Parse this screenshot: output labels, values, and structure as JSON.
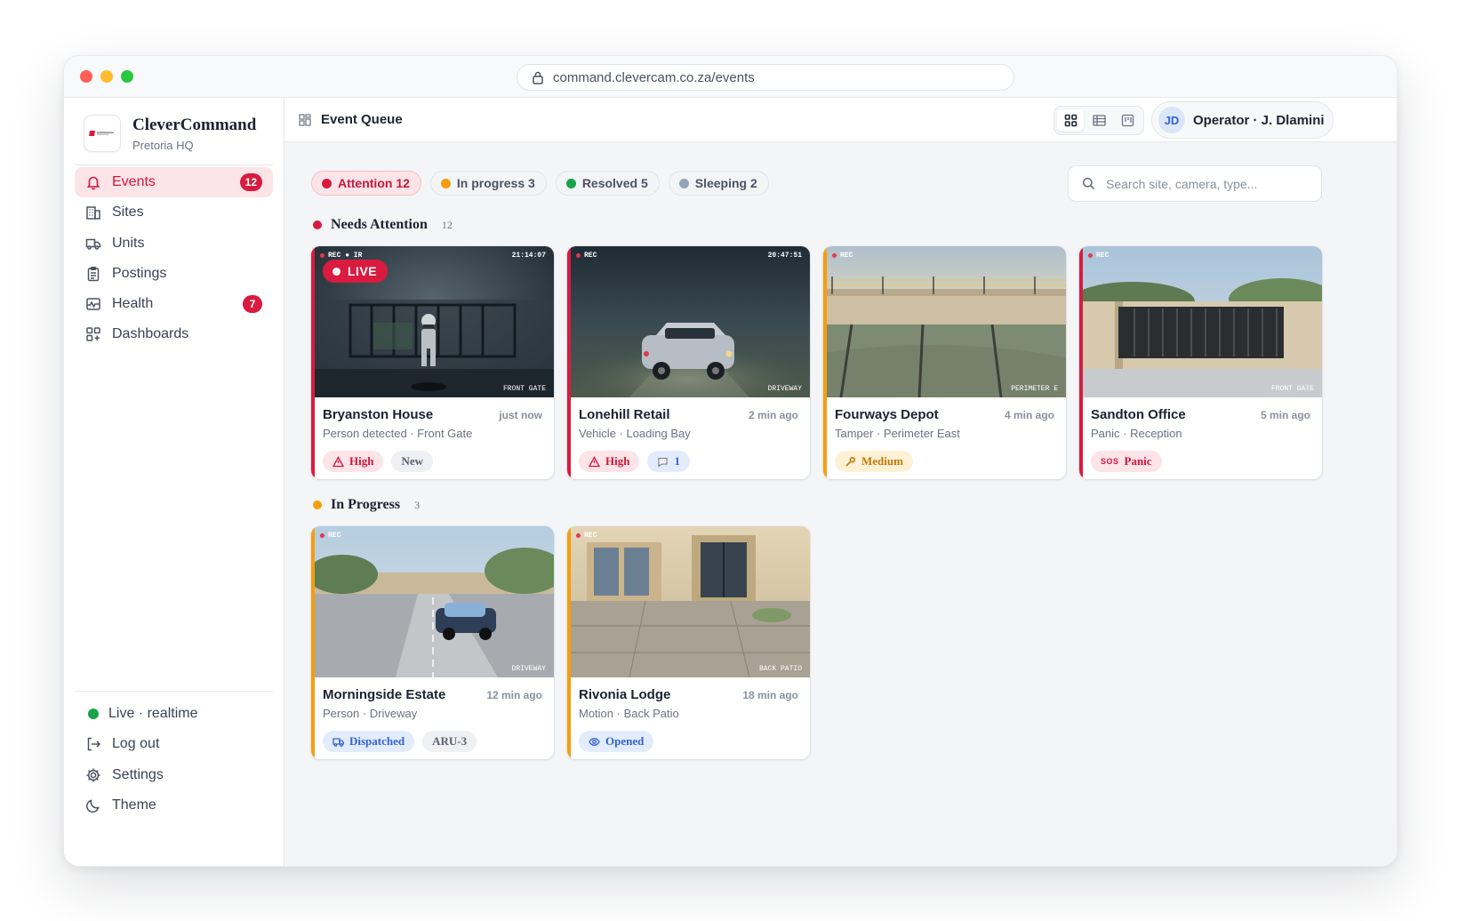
{
  "browser": {
    "url": "command.clevercam.co.za/events"
  },
  "brand": {
    "name": "CleverCommand",
    "location": "Pretoria HQ"
  },
  "nav": [
    {
      "label": "Events",
      "icon": "bell-icon",
      "badge": "12",
      "active": true
    },
    {
      "label": "Sites",
      "icon": "building-icon"
    },
    {
      "label": "Units",
      "icon": "truck-icon"
    },
    {
      "label": "Postings",
      "icon": "clipboard-icon"
    },
    {
      "label": "Health",
      "icon": "pulse-icon",
      "badge": "7"
    },
    {
      "label": "Dashboards",
      "icon": "dashboard-icon"
    }
  ],
  "sidebar_bottom": {
    "status": "Live · realtime",
    "logout": "Log out",
    "settings": "Settings",
    "theme": "Theme"
  },
  "topbar": {
    "title": "Event Queue",
    "operator_initials": "JD",
    "operator_name": "Operator · J. Dlamini",
    "view_modes": [
      "grid",
      "list",
      "map"
    ]
  },
  "filters": [
    {
      "label": "Attention 12",
      "color": "#d81b3f",
      "active": true
    },
    {
      "label": "In progress 3",
      "color": "#f59e0b"
    },
    {
      "label": "Resolved 5",
      "color": "#19a34a"
    },
    {
      "label": "Sleeping 2",
      "color": "#94a3b8"
    }
  ],
  "search": {
    "placeholder": "Search site, camera, type..."
  },
  "sections": {
    "attention": {
      "title": "Needs Attention",
      "count": "12",
      "color": "#d81b3f"
    },
    "progress": {
      "title": "In Progress",
      "count": "3",
      "color": "#f59e0b"
    }
  },
  "cards": [
    {
      "site": "Bryanston House",
      "ago": "just now",
      "meta": "Person detected · Front Gate",
      "rec": "REC ● IR",
      "timestamp": "21:14:07",
      "camera": "FRONT GATE",
      "live": "LIVE",
      "tags": [
        "High",
        "New"
      ]
    },
    {
      "site": "Lonehill Retail",
      "ago": "2 min ago",
      "meta": "Vehicle · Loading Bay",
      "rec": "REC",
      "timestamp": "20:47:51",
      "camera": "DRIVEWAY",
      "tags": [
        "High",
        "1"
      ]
    },
    {
      "site": "Fourways Depot",
      "ago": "4 min ago",
      "meta": "Tamper · Perimeter East",
      "rec": "REC",
      "camera": "PERIMETER E",
      "tags": [
        "Medium"
      ]
    },
    {
      "site": "Sandton Office",
      "ago": "5 min ago",
      "meta": "Panic · Reception",
      "rec": "REC",
      "camera": "FRONT GATE",
      "tags": [
        "SOS",
        "Panic"
      ]
    },
    {
      "site": "Morningside Estate",
      "ago": "12 min ago",
      "meta": "Person · Driveway",
      "rec": "REC",
      "camera": "DRIVEWAY",
      "tags": [
        "Dispatched",
        "ARU-3"
      ]
    },
    {
      "site": "Rivonia Lodge",
      "ago": "18 min ago",
      "meta": "Motion · Back Patio",
      "rec": "REC",
      "camera": "BACK PATIO",
      "tags": [
        "Opened"
      ]
    }
  ],
  "colors": {
    "accent_red": "#d81b3f",
    "accent_orange": "#f59e0b",
    "accent_blue": "#3463d6"
  }
}
